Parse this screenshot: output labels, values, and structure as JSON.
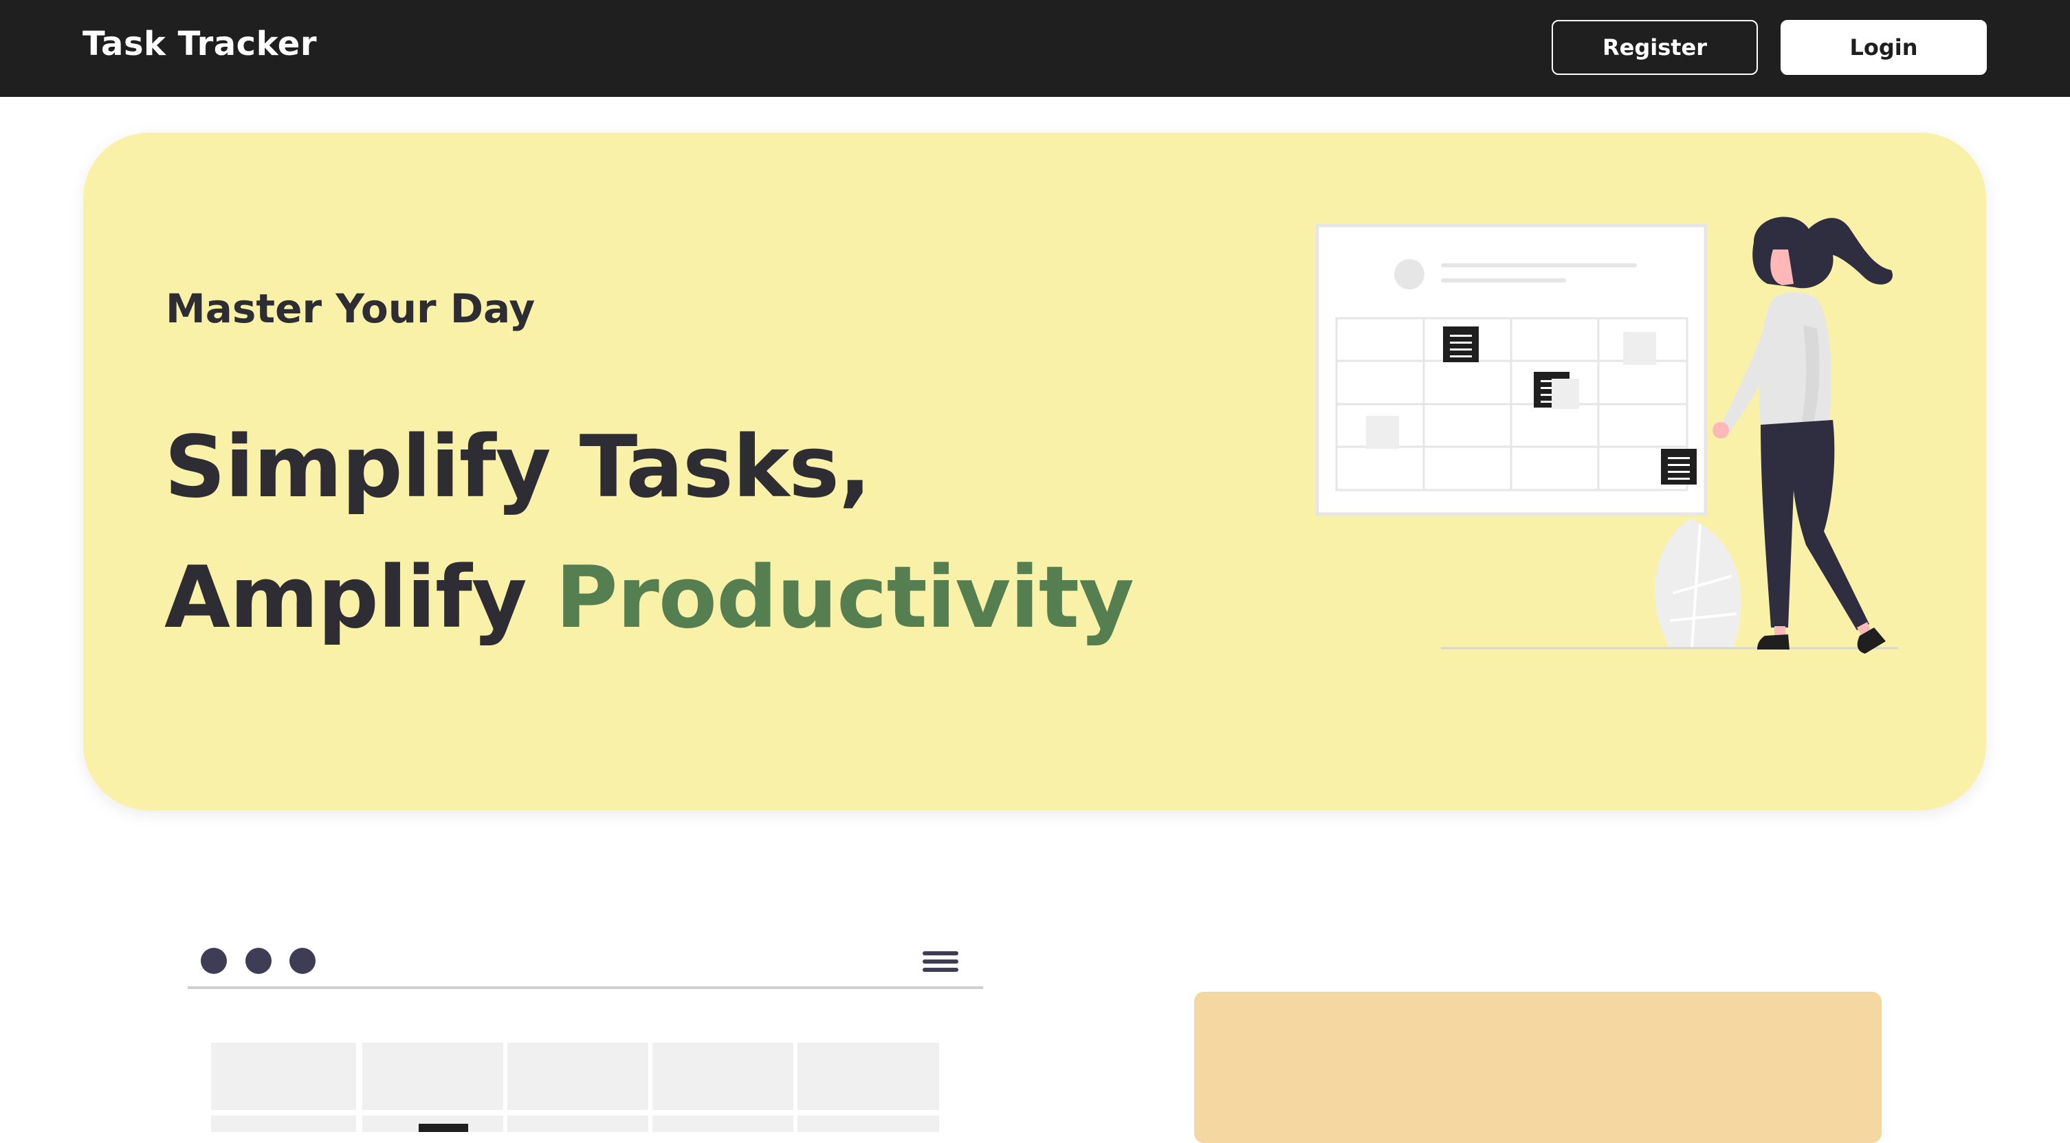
{
  "navbar": {
    "brand": "Task Tracker",
    "register_label": "Register",
    "login_label": "Login"
  },
  "hero": {
    "kicker": "Master Your Day",
    "headline_line1": "Simplify Tasks,",
    "headline_line2_prefix": "Amplify ",
    "headline_line2_accent": "Productivity"
  },
  "colors": {
    "navbar_bg": "#1f1f1f",
    "hero_bg": "#faf1a9",
    "accent_green": "#557f50",
    "text_dark": "#2d2d33",
    "card_peach": "#f5d7a2"
  },
  "icons": {
    "menu": "hamburger-menu-icon",
    "window_dots": "window-control-dots"
  }
}
